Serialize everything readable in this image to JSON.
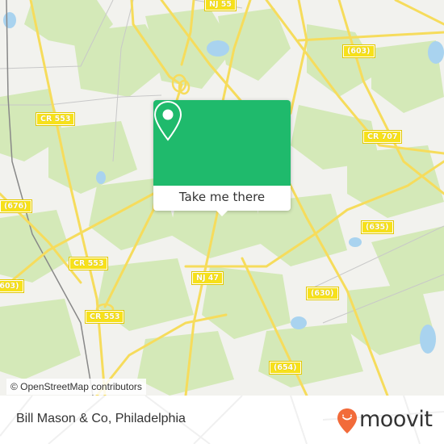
{
  "map": {
    "attribution": "© OpenStreetMap contributors",
    "road_labels": [
      {
        "id": "nj55-top",
        "text": "NJ 55"
      },
      {
        "id": "cr553-a",
        "text": "CR 553"
      },
      {
        "id": "cr553-b",
        "text": "CR 553"
      },
      {
        "id": "cr553-c",
        "text": "CR 553"
      },
      {
        "id": "603-top",
        "text": "(603)"
      },
      {
        "id": "cr707",
        "text": "CR 707"
      },
      {
        "id": "676",
        "text": "(676)"
      },
      {
        "id": "603-left",
        "text": "(603)"
      },
      {
        "id": "nj47",
        "text": "NJ 47"
      },
      {
        "id": "635",
        "text": "(635)"
      },
      {
        "id": "630",
        "text": "(630)"
      },
      {
        "id": "654",
        "text": "(654)"
      }
    ],
    "colors": {
      "land": "#f2f2ee",
      "park": "#d4e9b8",
      "water": "#a9d3ef",
      "road": "#f6dc5c",
      "shield": "#f7e11a"
    }
  },
  "popup": {
    "icon": "map-pin-icon",
    "button_label": "Take me there",
    "color": "#1fba6c"
  },
  "footer": {
    "place_name": "Bill Mason & Co, Philadelphia",
    "brand": "moovit",
    "brand_color": "#f26b3a"
  }
}
